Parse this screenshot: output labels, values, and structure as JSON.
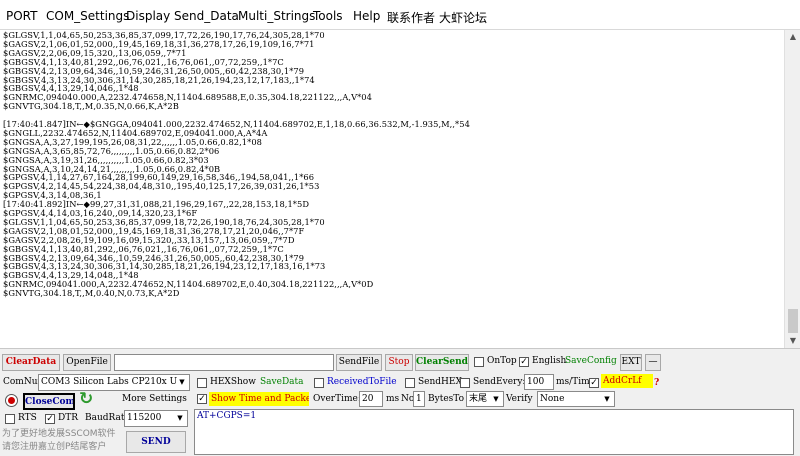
{
  "menu": [
    "PORT",
    "COM_Settings",
    "Display",
    "Send_Data",
    "Multi_Strings",
    "Tools",
    "Help",
    "联系作者",
    "大虾论坛"
  ],
  "log_lines": [
    "$GLGSV,1,1,04,65,50,253,36,85,37,099,17,72,26,190,17,76,24,305,28,1*70",
    "$GAGSV,2,1,06,01,52,000,,19,45,169,18,31,36,278,17,26,19,109,16,7*71",
    "$GAGSV,2,2,06,09,15,320,,13,06,059,,7*71",
    "$GBGSV,4,1,13,40,81,292,,06,76,021,,16,76,061,,07,72,259,,1*7C",
    "$GBGSV,4,2,13,09,64,346,,10,59,246,31,26,50,005,,60,42,238,30,1*79",
    "$GBGSV,4,3,13,24,30,306,31,14,30,285,18,21,26,194,23,12,17,183,,1*74",
    "$GBGSV,4,4,13,29,14,046,,1*48",
    "$GNRMC,094040.000,A,2232.474658,N,11404.689588,E,0.35,304.18,221122,,,A,V*04",
    "$GNVTG,304.18,T,,M,0.35,N,0.66,K,A*2B",
    "",
    "[17:40:41.847]IN←◆$GNGGA,094041.000,2232.474652,N,11404.689702,E,1,18,0.66,36.532,M,-1.935,M,,*54",
    "$GNGLL,2232.474652,N,11404.689702,E,094041.000,A,A*4A",
    "$GNGSA,A,3,27,199,195,26,08,31,22,,,,,,1.05,0.66,0.82,1*08",
    "$GNGSA,A,3,65,85,72,76,,,,,,,,,1.05,0.66,0.82,2*06",
    "$GNGSA,A,3,19,31,26,,,,,,,,,,1.05,0.66,0.82,3*03",
    "$GNGSA,A,3,10,24,14,21,,,,,,,,,1.05,0.66,0.82,4*0B",
    "$GPGSV,4,1,14,27,67,164,28,199,60,149,29,16,58,346,,194,58,041,,1*66",
    "$GPGSV,4,2,14,45,54,224,38,04,48,310,,195,40,125,17,26,39,031,26,1*53",
    "$GPGSV,4,3,14,08,36,1",
    "[17:40:41.892]IN←◆99,27,31,31,088,21,196,29,167,,22,28,153,18,1*5D",
    "$GPGSV,4,4,14,03,16,240,,09,14,320,23,1*6F",
    "$GLGSV,1,1,04,65,50,253,36,85,37,099,18,72,26,190,18,76,24,305,28,1*70",
    "$GAGSV,2,1,08,01,52,000,,19,45,169,18,31,36,278,17,21,20,046,,7*7F",
    "$GAGSV,2,2,08,26,19,109,16,09,15,320,,33,13,157,,13,06,059,,7*7D",
    "$GBGSV,4,1,13,40,81,292,,06,76,021,,16,76,061,,07,72,259,,1*7C",
    "$GBGSV,4,2,13,09,64,346,,10,59,246,31,26,50,005,,60,42,238,30,1*79",
    "$GBGSV,4,3,13,24,30,306,31,14,30,285,18,21,26,194,23,12,17,183,16,1*73",
    "$GBGSV,4,4,13,29,14,048,,1*48",
    "$GNRMC,094041.000,A,2232.474652,N,11404.689702,E,0.40,304.18,221122,,,A,V*0D",
    "$GNVTG,304.18,T,,M,0.40,N,0.73,K,A*2D"
  ],
  "controls": {
    "clear_data": "ClearData",
    "open_file": "OpenFile",
    "file_path": "",
    "send_file": "SendFile",
    "stop": "Stop",
    "clear_send": "ClearSend",
    "on_top": "OnTop",
    "english": "English",
    "save_config": "SaveConfig",
    "ext": "EXT",
    "minus": "—",
    "com_num_label": "ComNum",
    "com_port": "COM3 Silicon Labs CP210x U",
    "close_com": "CloseCom",
    "more_settings": "More Settings",
    "rts": "RTS",
    "dtr": "DTR",
    "baud_label": "BaudRat",
    "baud_value": "115200",
    "hex_show": "HEXShow",
    "save_data": "SaveData",
    "received_to_file": "ReceivedToFile",
    "send_hex": "SendHEX",
    "send_every": "SendEvery:",
    "send_every_value": "100",
    "ms_tim": "ms/Tim",
    "add_crlf": "AddCrLf",
    "show_time": "Show Time and Packe",
    "overtime": "OverTime:",
    "overtime_value": "20",
    "ms": "ms",
    "no": "No",
    "no_value": "1",
    "bytes_to": "BytesTo",
    "bytes_to_value": "末尾",
    "verify": "Verify",
    "verify_value": "None",
    "send_text": "AT+CGPS=1",
    "promo": "为了更好地发展SSCOM软件\n请您注册嘉立创P结尾客户",
    "send": "SEND",
    "help_mark": "?"
  },
  "colors": {
    "clear_data": "#cc0000",
    "stop": "#cc0000",
    "clear_send": "#008000",
    "save_config": "#008000",
    "save_data": "#008000",
    "received_to_file": "#0000cc",
    "show_time_bg": "#ffff00",
    "add_crlf_bg": "#ffff00",
    "close_com_text": "#000099",
    "send_text_color": "#000099",
    "refresh_icon": "#2e9a2e"
  }
}
